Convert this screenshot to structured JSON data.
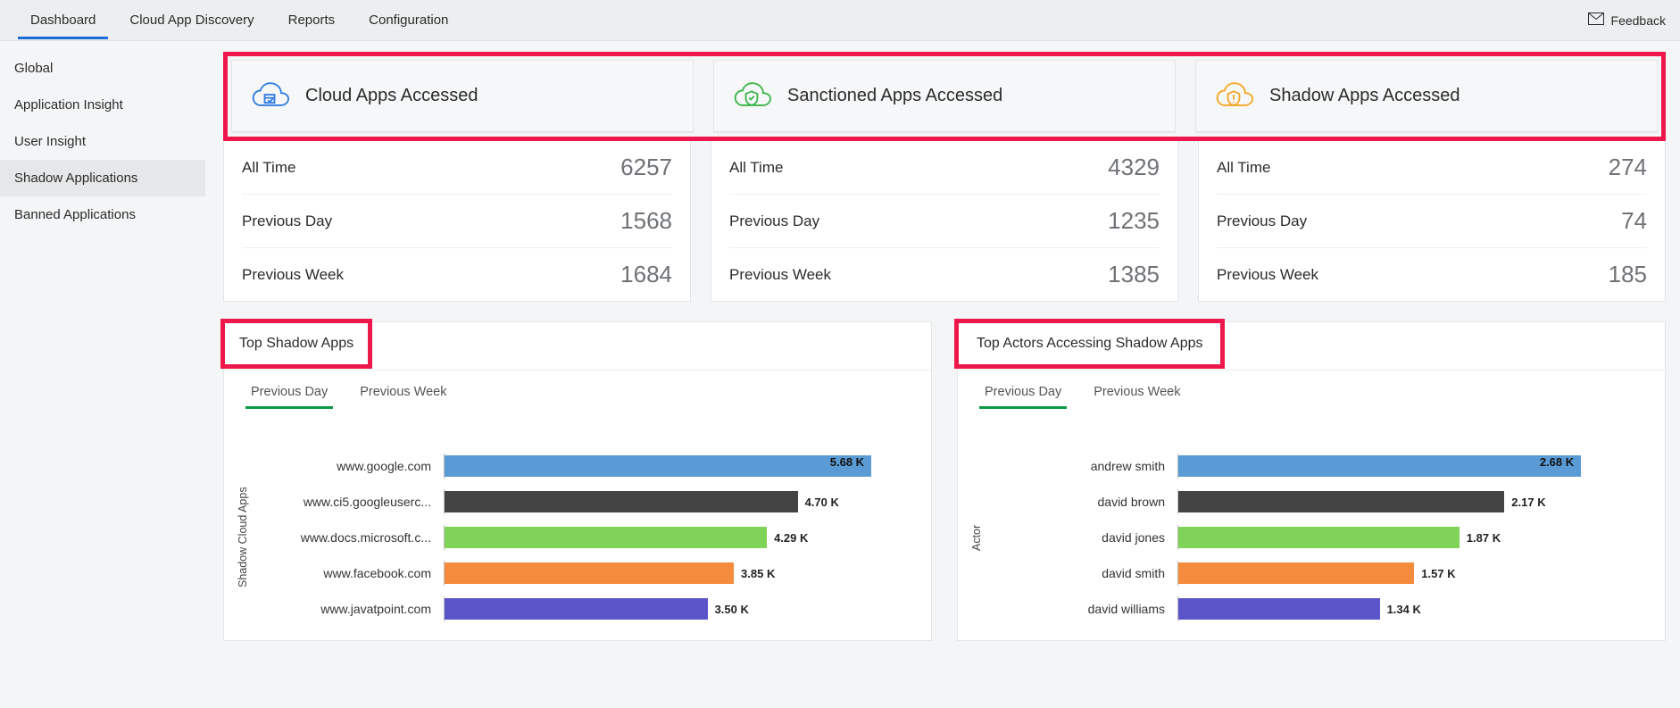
{
  "topnav": {
    "items": [
      {
        "label": "Dashboard",
        "active": true
      },
      {
        "label": "Cloud App Discovery",
        "active": false
      },
      {
        "label": "Reports",
        "active": false
      },
      {
        "label": "Configuration",
        "active": false
      }
    ],
    "feedback_label": "Feedback"
  },
  "sidebar": {
    "items": [
      {
        "label": "Global",
        "active": false
      },
      {
        "label": "Application Insight",
        "active": false
      },
      {
        "label": "User Insight",
        "active": false
      },
      {
        "label": "Shadow Applications",
        "active": true
      },
      {
        "label": "Banned Applications",
        "active": false
      }
    ]
  },
  "stat_cards": [
    {
      "title": "Cloud Apps Accessed",
      "icon": "cloud-icon",
      "icon_color": "#2f7de1",
      "rows": [
        {
          "label": "All Time",
          "value": "6257"
        },
        {
          "label": "Previous Day",
          "value": "1568"
        },
        {
          "label": "Previous Week",
          "value": "1684"
        }
      ]
    },
    {
      "title": "Sanctioned Apps Accessed",
      "icon": "shield-cloud-icon",
      "icon_color": "#3bb54a",
      "rows": [
        {
          "label": "All Time",
          "value": "4329"
        },
        {
          "label": "Previous Day",
          "value": "1235"
        },
        {
          "label": "Previous Week",
          "value": "1385"
        }
      ]
    },
    {
      "title": "Shadow Apps Accessed",
      "icon": "warn-cloud-icon",
      "icon_color": "#f5a623",
      "rows": [
        {
          "label": "All Time",
          "value": "274"
        },
        {
          "label": "Previous Day",
          "value": "74"
        },
        {
          "label": "Previous Week",
          "value": "185"
        }
      ]
    }
  ],
  "panel_tabs": [
    {
      "label": "Previous Day",
      "active": true
    },
    {
      "label": "Previous Week",
      "active": false
    }
  ],
  "chart_colors": [
    "#5a9bd5",
    "#444444",
    "#7fd358",
    "#f58b3c",
    "#5c55c9"
  ],
  "chart_data": [
    {
      "type": "bar",
      "title": "Top Shadow Apps",
      "ylabel": "Shadow Cloud Apps",
      "xlabel": "",
      "xlim": [
        0,
        6
      ],
      "categories": [
        "www.google.com",
        "www.ci5.googleuserc...",
        "www.docs.microsoft.c...",
        "www.facebook.com",
        "www.javatpoint.com"
      ],
      "values": [
        5.68,
        4.7,
        4.29,
        3.85,
        3.5
      ],
      "value_labels": [
        "5.68 K",
        "4.70 K",
        "4.29 K",
        "3.85 K",
        "3.50 K"
      ]
    },
    {
      "type": "bar",
      "title": "Top Actors Accessing Shadow Apps",
      "ylabel": "Actor",
      "xlabel": "",
      "xlim": [
        0,
        3
      ],
      "categories": [
        "andrew smith",
        "david brown",
        "david jones",
        "david smith",
        "david williams"
      ],
      "values": [
        2.68,
        2.17,
        1.87,
        1.57,
        1.34
      ],
      "value_labels": [
        "2.68 K",
        "2.17 K",
        "1.87 K",
        "1.57 K",
        "1.34 K"
      ]
    }
  ]
}
